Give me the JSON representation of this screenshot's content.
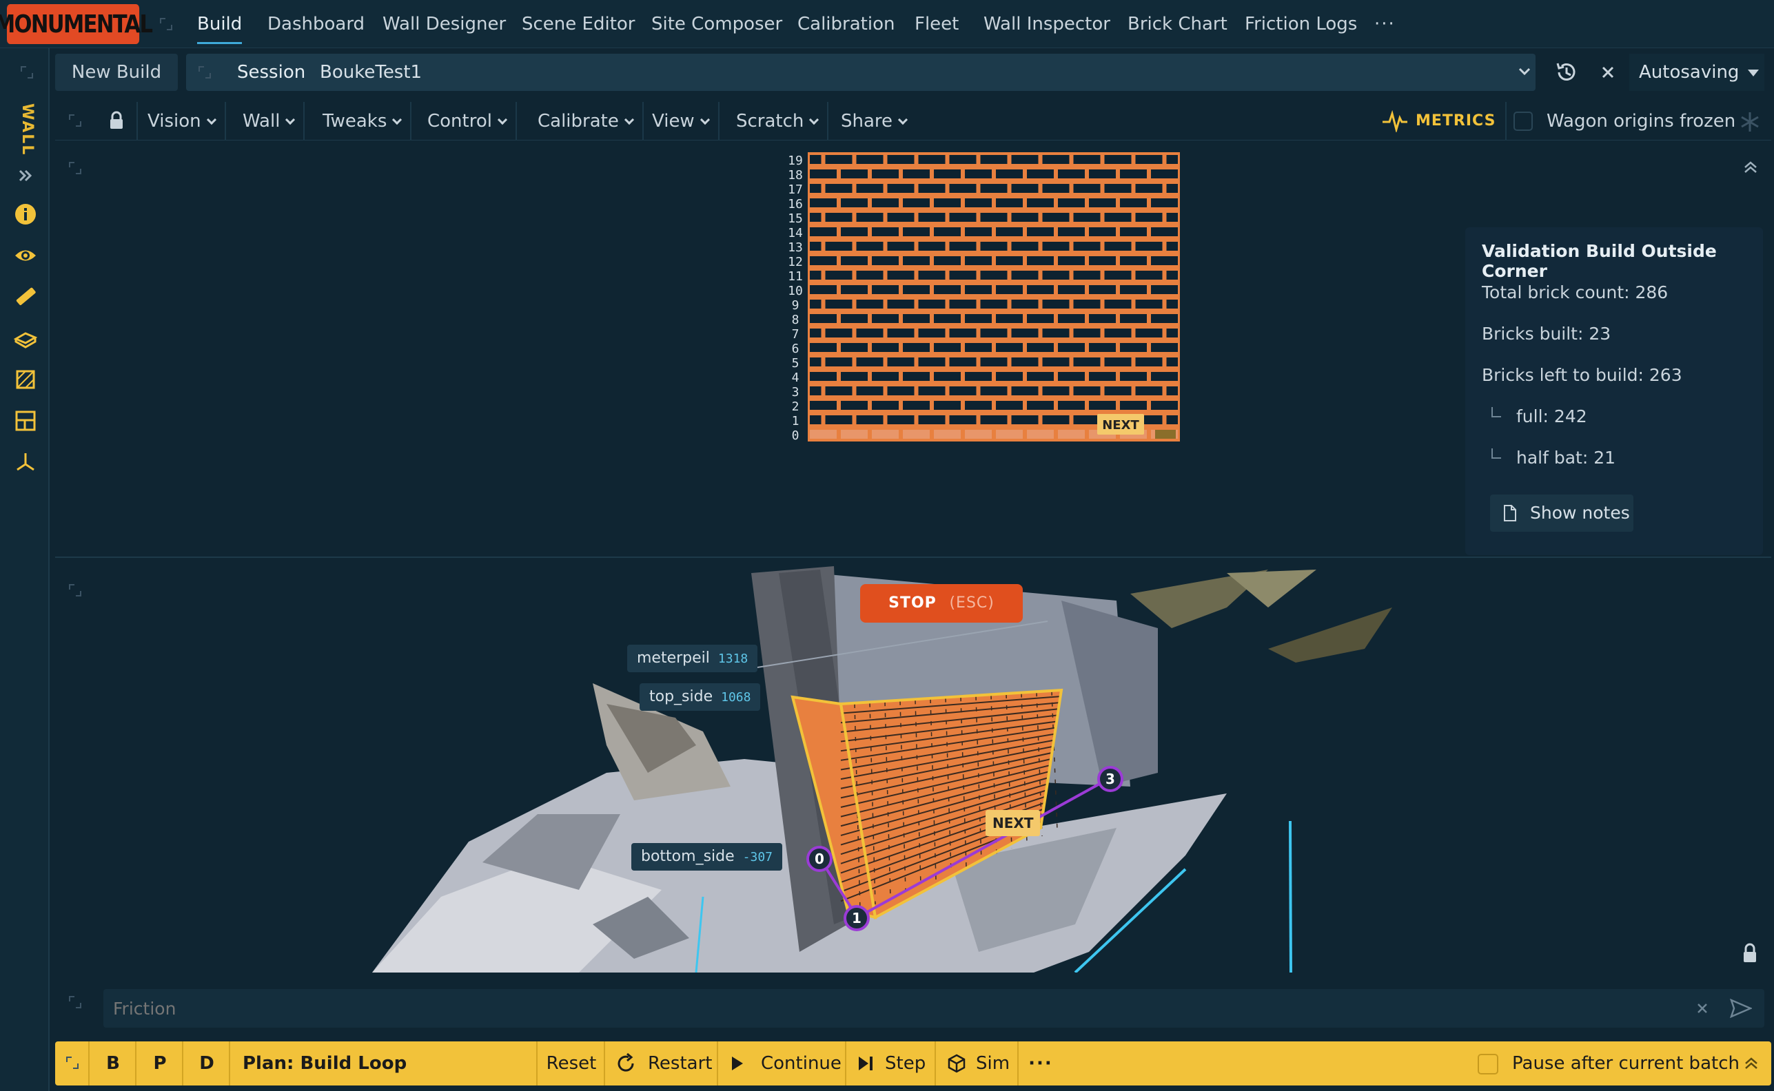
{
  "app": {
    "logo": "MONUMENTAL"
  },
  "nav": {
    "tabs": [
      "Build",
      "Dashboard",
      "Wall Designer",
      "Scene Editor",
      "Site Composer",
      "Calibration",
      "Fleet",
      "Wall Inspector",
      "Brick Chart",
      "Friction Logs"
    ],
    "more": "···"
  },
  "session": {
    "new_build": "New Build",
    "label": "Session",
    "name": "BoukeTest1",
    "autosave": "Autosaving"
  },
  "toolbar": {
    "menus": [
      "Vision",
      "Wall",
      "Tweaks",
      "Control",
      "Calibrate",
      "View",
      "Scratch",
      "Share"
    ],
    "metrics": "METRICS",
    "wagon": "Wagon origins frozen"
  },
  "sidebar": {
    "wall_label": "WALL"
  },
  "brick_chart": {
    "rows": [
      "0",
      "1",
      "2",
      "3",
      "4",
      "5",
      "6",
      "7",
      "8",
      "9",
      "10",
      "11",
      "12",
      "13",
      "14",
      "15",
      "16",
      "17",
      "18",
      "19"
    ],
    "next_label": "NEXT",
    "colors": {
      "mortar": "#e8803f",
      "brick": "#0d2230",
      "built": "#e8803f"
    }
  },
  "validation": {
    "title": "Validation Build Outside Corner",
    "total": "Total brick count: 286",
    "built": "Bricks built: 23",
    "left": "Bricks left to build: 263",
    "full": "full: 242",
    "half": "half bat: 21",
    "show_notes": "Show notes"
  },
  "scene": {
    "stop": "STOP",
    "stop_key": "(ESC)",
    "next": "NEXT",
    "tags": [
      {
        "label": "meterpeil",
        "value": "1318"
      },
      {
        "label": "top_side",
        "value": "1068"
      },
      {
        "label": "bottom_side",
        "value": "-307"
      }
    ],
    "markers": [
      "0",
      "1",
      "3"
    ]
  },
  "friction": {
    "placeholder": "Friction"
  },
  "bottom": {
    "b": "B",
    "p": "P",
    "d": "D",
    "plan": "Plan: Build Loop",
    "reset": "Reset",
    "restart": "Restart",
    "continue": "Continue",
    "step": "Step",
    "sim": "Sim",
    "more": "···",
    "pause": "Pause after current batch"
  }
}
